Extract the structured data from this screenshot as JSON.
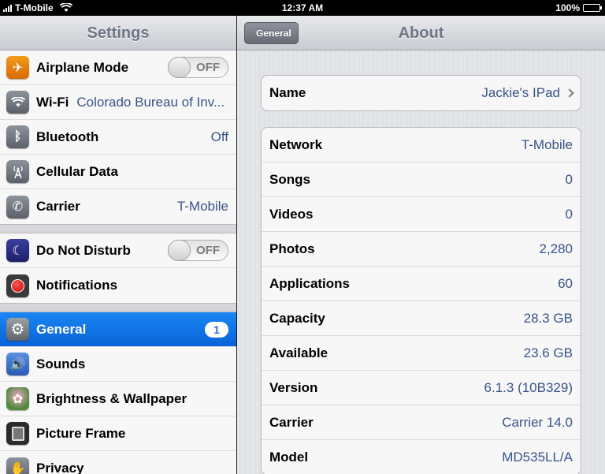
{
  "status_bar": {
    "carrier": "T-Mobile",
    "time": "12:37 AM",
    "battery": "100%",
    "battery_level": 1.0
  },
  "master": {
    "title": "Settings",
    "groups": [
      [
        {
          "label": "Airplane Mode",
          "icon": "airplane-icon",
          "toggle": "OFF"
        },
        {
          "label": "Wi-Fi",
          "icon": "wifi-icon",
          "value": "Colorado Bureau of Inv..."
        },
        {
          "label": "Bluetooth",
          "icon": "bluetooth-icon",
          "value": "Off"
        },
        {
          "label": "Cellular Data",
          "icon": "cellular-antenna-icon"
        },
        {
          "label": "Carrier",
          "icon": "phone-icon",
          "value": "T-Mobile"
        }
      ],
      [
        {
          "label": "Do Not Disturb",
          "icon": "moon-icon",
          "toggle": "OFF"
        },
        {
          "label": "Notifications",
          "icon": "notifications-icon"
        }
      ],
      [
        {
          "label": "General",
          "icon": "gear-icon",
          "badge": "1",
          "selected": true
        },
        {
          "label": "Sounds",
          "icon": "speaker-icon"
        },
        {
          "label": "Brightness & Wallpaper",
          "icon": "flower-icon"
        },
        {
          "label": "Picture Frame",
          "icon": "picture-frame-icon"
        },
        {
          "label": "Privacy",
          "icon": "hand-icon"
        }
      ]
    ]
  },
  "detail": {
    "title": "About",
    "back_label": "General",
    "name_row": {
      "label": "Name",
      "value": "Jackie's IPad"
    },
    "rows": [
      {
        "label": "Network",
        "value": "T-Mobile"
      },
      {
        "label": "Songs",
        "value": "0"
      },
      {
        "label": "Videos",
        "value": "0"
      },
      {
        "label": "Photos",
        "value": "2,280"
      },
      {
        "label": "Applications",
        "value": "60"
      },
      {
        "label": "Capacity",
        "value": "28.3 GB"
      },
      {
        "label": "Available",
        "value": "23.6 GB"
      },
      {
        "label": "Version",
        "value": "6.1.3 (10B329)"
      },
      {
        "label": "Carrier",
        "value": "Carrier 14.0"
      },
      {
        "label": "Model",
        "value": "MD535LL/A"
      }
    ]
  },
  "colors": {
    "value_blue": "#385487",
    "selected_blue": "#0963d6"
  }
}
